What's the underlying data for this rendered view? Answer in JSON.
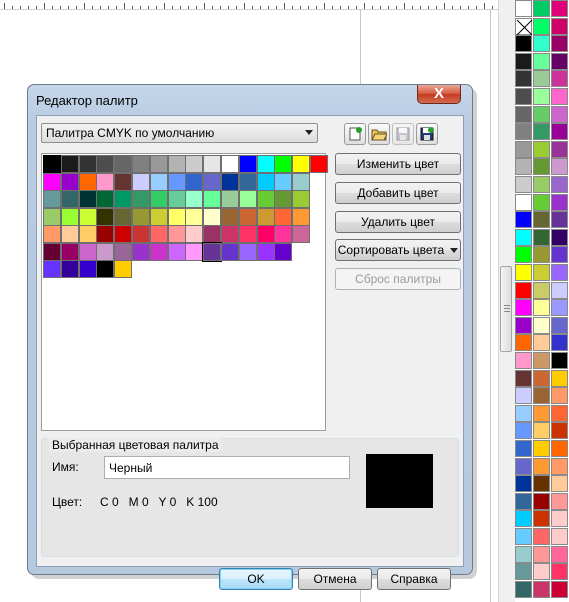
{
  "dialog": {
    "title": "Редактор палитр",
    "close_label": "X",
    "palette_select": "Палитра CMYK по умолчанию",
    "toolbar_icons": [
      "new-palette-icon",
      "open-palette-icon",
      "save-palette-icon",
      "save-as-palette-icon"
    ],
    "buttons": {
      "edit_color": "Изменить цвет",
      "add_color": "Добавить цвет",
      "delete_color": "Удалить цвет",
      "sort_colors": "Сортировать цвета",
      "reset_palette": "Сброс палитры"
    },
    "group": {
      "title": "Выбранная цветовая палитра",
      "name_label": "Имя:",
      "name_value": "Черный",
      "color_label": "Цвет:",
      "cmyk": "C 0   M 0   Y 0   K 100",
      "preview_color": "#000000"
    },
    "footer": {
      "ok": "OK",
      "cancel": "Отмена",
      "help": "Справка"
    }
  },
  "palette_grid": [
    [
      "#000000",
      "#1a1a1a",
      "#333333",
      "#4d4d4d",
      "#666666",
      "#808080",
      "#999999",
      "#b3b3b3",
      "#cccccc",
      "#e6e6e6",
      "#ffffff",
      "#0000ff",
      "#00ffff",
      "#00ff00",
      "#ffff00",
      "#ff0000"
    ],
    [
      "#ff00ff",
      "#9900cc",
      "#ff6600",
      "#ff99cc",
      "#663333",
      "#ccccff",
      "#99ccff",
      "#6699ff",
      "#3366cc",
      "#6666cc",
      "#003399",
      "#336699",
      "#00ccff",
      "#66ccff",
      "#99cccc"
    ],
    [
      "#669999",
      "#336666",
      "#003333",
      "#006633",
      "#009966",
      "#339966",
      "#33cc66",
      "#66cc99",
      "#99ffcc",
      "#66ff99",
      "#99cc99",
      "#99ff99",
      "#66cc33",
      "#669933",
      "#99cc33"
    ],
    [
      "#99cc66",
      "#99ff33",
      "#ccff33",
      "#333300",
      "#666633",
      "#999933",
      "#cccc33",
      "#ffff66",
      "#ffff99",
      "#ffffcc",
      "#996633",
      "#cc6633",
      "#cc9933",
      "#ff6633",
      "#ff9933"
    ],
    [
      "#ff9966",
      "#ffcc99",
      "#ffcc66",
      "#990000",
      "#cc0000",
      "#cc3333",
      "#ff6666",
      "#ff9999",
      "#ffcccc",
      "#993366",
      "#cc3366",
      "#ff3366",
      "#ff0066",
      "#ff3399",
      "#cc6699"
    ],
    [
      "#660033",
      "#990066",
      "#cc66cc",
      "#cc99cc",
      "#996699",
      "#9933cc",
      "#cc33cc",
      "#cc66ff",
      "#ff99ff",
      "#663399",
      "#6633cc",
      "#9966ff",
      "#9933ff",
      "#6600cc"
    ],
    [
      "#6633ff",
      "#330099",
      "#3300cc",
      "#000000",
      "#ffcc00"
    ]
  ],
  "side_palette": [
    [
      "#ffffff",
      "#00cc66",
      "#e0007a"
    ],
    [
      "none",
      "#00ff66",
      "#cc0066"
    ],
    [
      "#000000",
      "#33ffcc",
      "#990066"
    ],
    [
      "#1a1a1a",
      "#66ff99",
      "#660066"
    ],
    [
      "#333333",
      "#99cc99",
      "#cc3399"
    ],
    [
      "#4d4d4d",
      "#99ff99",
      "#ff66cc"
    ],
    [
      "#666666",
      "#66cc66",
      "#cc66cc"
    ],
    [
      "#808080",
      "#339966",
      "#990099"
    ],
    [
      "#999999",
      "#99cc33",
      "#993399"
    ],
    [
      "#b3b3b3",
      "#669933",
      "#cc99cc"
    ],
    [
      "#cccccc",
      "#99cc66",
      "#9966cc"
    ],
    [
      "#ffffff",
      "#66cc33",
      "#9933cc"
    ],
    [
      "#0000ff",
      "#666633",
      "#663399"
    ],
    [
      "#00ffff",
      "#336633",
      "#330066"
    ],
    [
      "#00ff00",
      "#999933",
      "#6633cc"
    ],
    [
      "#ffff00",
      "#cccc33",
      "#9966ff"
    ],
    [
      "#ff0000",
      "#cccc66",
      "#ccccff"
    ],
    [
      "#ff00ff",
      "#ffff99",
      "#9999ff"
    ],
    [
      "#9900cc",
      "#ffffcc",
      "#6666cc"
    ],
    [
      "#ff6600",
      "#ffcc99",
      "#3333cc"
    ],
    [
      "#ff99cc",
      "#cc9966",
      "#000000"
    ],
    [
      "#663333",
      "#cc6633",
      "#ffcc00"
    ],
    [
      "#ccccff",
      "#996633",
      "#ff9966"
    ],
    [
      "#99ccff",
      "#ff9933",
      "#ff6633"
    ],
    [
      "#6699ff",
      "#ffcc66",
      "#cc3300"
    ],
    [
      "#3366cc",
      "#ffcc00",
      "#ff6600"
    ],
    [
      "#6666cc",
      "#ff9933",
      "#ff9966"
    ],
    [
      "#003399",
      "#663300",
      "#ffcc99"
    ],
    [
      "#336699",
      "#990000",
      "#ff9999"
    ],
    [
      "#00ccff",
      "#cc3300",
      "#ffcccc"
    ],
    [
      "#66ccff",
      "#ff6666",
      "#ffcccc"
    ],
    [
      "#99cccc",
      "#ff9999",
      "#ff6699"
    ],
    [
      "#669999",
      "#ffcccc",
      "#ff3366"
    ],
    [
      "#336666",
      "#cc3366",
      "#cc0033"
    ]
  ]
}
